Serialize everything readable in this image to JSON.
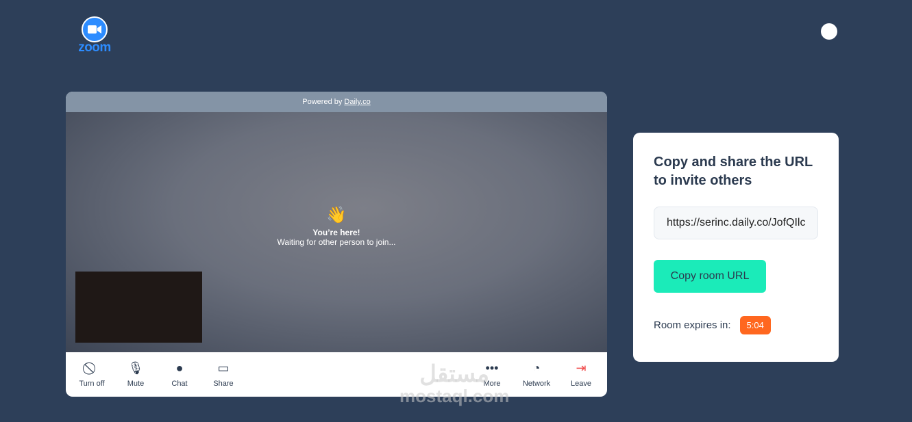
{
  "header": {
    "logo_text": "zoom",
    "github_icon": "github-icon"
  },
  "call": {
    "powered_prefix": "Powered by ",
    "powered_link": "Daily.co",
    "wave": "👋",
    "title": "You’re here!",
    "subtitle": "Waiting for other person to join...",
    "controls": [
      {
        "label": "Turn off",
        "icon": "camera-off-icon"
      },
      {
        "label": "Mute",
        "icon": "mic-off-icon"
      },
      {
        "label": "Chat",
        "icon": "chat-icon"
      },
      {
        "label": "Share",
        "icon": "screen-share-icon"
      },
      {
        "label": "More",
        "icon": "more-icon"
      },
      {
        "label": "Network",
        "icon": "network-icon"
      },
      {
        "label": "Leave",
        "icon": "leave-icon"
      }
    ],
    "leave_color": "#f04c4c"
  },
  "watermark": {
    "arabic": "مستقل",
    "latin": "mostaql.com"
  },
  "share": {
    "title": "Copy and share the URL to invite others",
    "url": "https://serinc.daily.co/JofQIlc",
    "copy_label": "Copy room URL",
    "expires_label": "Room expires in:",
    "expires_value": "5:04",
    "button_color": "#1bebb9",
    "badge_color": "#ff671f"
  }
}
